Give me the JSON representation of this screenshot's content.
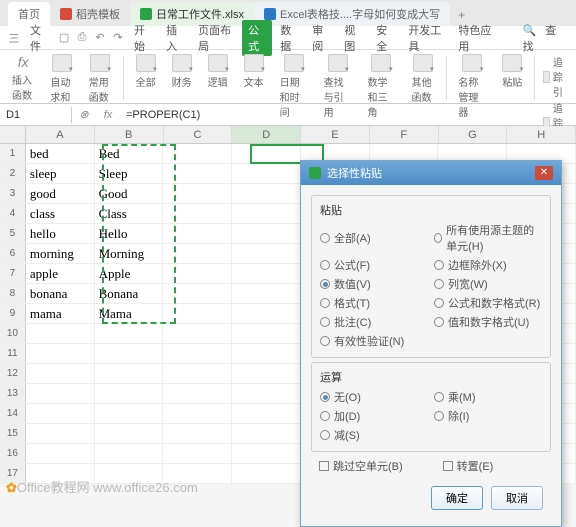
{
  "tabs": {
    "home": "首页",
    "file0": "稻壳模板",
    "file1": "日常工作文件.xlsx",
    "file2": "Excel表格技....字母如何变成大写",
    "plus": "+"
  },
  "menu": {
    "m0": "三",
    "m1": "文件",
    "m2": "开始",
    "m3": "插入",
    "m4": "页面布局",
    "m5": "公式",
    "m6": "数据",
    "m7": "审阅",
    "m8": "视图",
    "m9": "安全",
    "m10": "开发工具",
    "m11": "特色应用",
    "search": "查找"
  },
  "ribbon": {
    "fx": "fx",
    "g0": "插入函数",
    "g1": "自动求和",
    "g2": "常用函数",
    "g3": "全部",
    "g4": "财务",
    "g5": "逻辑",
    "g6": "文本",
    "g7": "日期和时间",
    "g8": "查找与引用",
    "g9": "数学和三角",
    "g10": "其他函数",
    "g11": "名称管理器",
    "g12": "粘贴",
    "r0": "追踪引",
    "r1": "追踪从"
  },
  "formula": {
    "cell": "D1",
    "fx": "fx",
    "value": "=PROPER(C1)"
  },
  "cols": {
    "A": "A",
    "B": "B",
    "C": "C",
    "D": "D",
    "E": "E",
    "F": "F",
    "G": "G",
    "H": "H"
  },
  "data": {
    "a": [
      "bed",
      "sleep",
      "good",
      "class",
      "hello",
      "morning",
      "apple",
      "bonana",
      "mama"
    ],
    "b": [
      "Bed",
      "Sleep",
      "Good",
      "Class",
      "Hello",
      "Morning",
      "Apple",
      "Bonana",
      "Mama"
    ]
  },
  "dialog": {
    "title": "选择性粘贴",
    "sect1": "粘贴",
    "o1": "全部(A)",
    "o2": "所有使用源主题的单元(H)",
    "o3": "公式(F)",
    "o4": "边框除外(X)",
    "o5": "数值(V)",
    "o6": "列宽(W)",
    "o7": "格式(T)",
    "o8": "公式和数字格式(R)",
    "o9": "批注(C)",
    "o10": "值和数字格式(U)",
    "o11": "有效性验证(N)",
    "sect2": "运算",
    "p1": "无(O)",
    "p2": "乘(M)",
    "p3": "加(D)",
    "p4": "除(I)",
    "p5": "减(S)",
    "c1": "跳过空单元(B)",
    "c2": "转置(E)",
    "ok": "确定",
    "cancel": "取消"
  },
  "watermark": {
    "site": "www.office26.com",
    "brand": "Office教程网 "
  }
}
